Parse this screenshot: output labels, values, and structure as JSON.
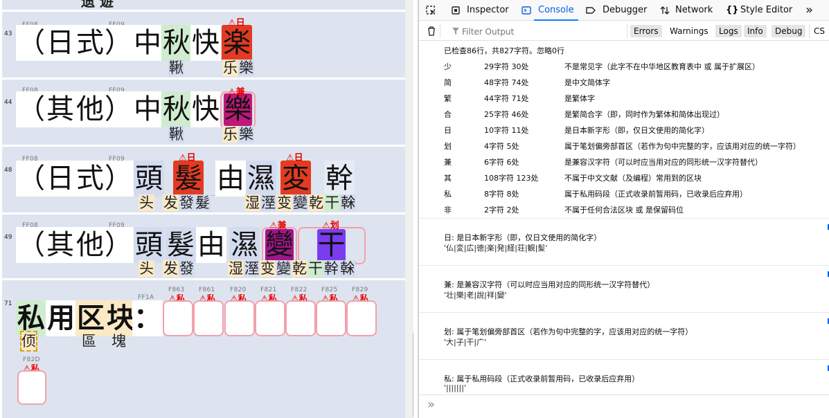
{
  "editor": {
    "top_fragment": "遗 遊",
    "lines": [
      {
        "num": "43",
        "hex1": "FF08",
        "hex2": "FF09",
        "chars": [
          "（",
          "日",
          "式",
          "）",
          "中",
          "秋",
          "快",
          "楽"
        ],
        "badge": "⚠日",
        "subs": [
          "鞦",
          "乐",
          "樂"
        ]
      },
      {
        "num": "44",
        "hex1": "FF08",
        "hex2": "FF09",
        "chars": [
          "（",
          "其",
          "他",
          "）",
          "中",
          "秋",
          "快",
          "樂"
        ],
        "badge": "⚠兼",
        "subs": [
          "鞦",
          "乐",
          "樂"
        ]
      },
      {
        "num": "48",
        "hex1": "FF08",
        "hex2": "FF09",
        "chars": [
          "（",
          "日",
          "式",
          "）",
          "頭",
          "髮",
          "由",
          "濕",
          "変",
          "幹"
        ],
        "badges": [
          "⚠日",
          "⚠日"
        ],
        "subs": [
          "头",
          "发",
          "發",
          "髮",
          "湿",
          "溼",
          "变",
          "變",
          "乾",
          "干",
          "榦"
        ]
      },
      {
        "num": "49",
        "hex1": "FF08",
        "hex2": "FF09",
        "chars": [
          "（",
          "其",
          "他",
          "）",
          "頭",
          "髮",
          "由",
          "濕",
          "變",
          "干"
        ],
        "badges": [
          "⚠兼",
          "⚠划"
        ],
        "subs": [
          "头",
          "发",
          "發",
          "湿",
          "溼",
          "变",
          "變",
          "乾",
          "干",
          "幹",
          "榦"
        ]
      },
      {
        "num": "71",
        "hex_colon": "FF1A",
        "chars": [
          "私",
          "用",
          "区",
          "块",
          "：",
          "",
          "",
          "",
          "",
          "",
          "",
          ""
        ],
        "hexes": [
          "F863",
          "F861",
          "F820",
          "F821",
          "F822",
          "F825",
          "F829",
          "F82D"
        ],
        "badge": "⚠私",
        "subs": [
          "㑔",
          "區",
          "塊"
        ]
      }
    ]
  },
  "devtools": {
    "tabs": [
      {
        "label": "Inspector"
      },
      {
        "label": "Console"
      },
      {
        "label": "Debugger"
      },
      {
        "label": "Network"
      },
      {
        "label": "Style Editor"
      }
    ],
    "more": "»",
    "filter_placeholder": "Filter Output",
    "levels": [
      "Errors",
      "Warnings",
      "Logs",
      "Info",
      "Debug",
      "CS"
    ],
    "summary": "已检查86行，共827字符。忽略0行",
    "stats": [
      {
        "k": "少",
        "n": "29字符 30处",
        "d": "不是常见字（此字不在中华地区教育表中 或 属于扩展区）"
      },
      {
        "k": "简",
        "n": "48字符 74处",
        "d": "是中文简体字"
      },
      {
        "k": "繁",
        "n": "44字符 71处",
        "d": "是繁体字"
      },
      {
        "k": "合",
        "n": "25字符 46处",
        "d": "是繁简合字（即，同时作为繁体和简体出现过）"
      },
      {
        "k": "日",
        "n": "10字符 11处",
        "d": "是日本新字形（即，仅日文使用的简化字）"
      },
      {
        "k": "划",
        "n": "4字符 5处",
        "d": "属于笔划偏旁部首区（若作为句中完整的字，应该用对应的统一字符）"
      },
      {
        "k": "兼",
        "n": "6字符 6处",
        "d": "是兼容汉字符（可以时应当用对应的同形统一汉字符替代）"
      },
      {
        "k": "其",
        "n": "108字符 123处",
        "d": "不属于中文文献（及编程）常用到的区块"
      },
      {
        "k": "私",
        "n": "8字符 8处",
        "d": "属于私用码段（正式收录前暂用码，已收录后应弃用）"
      },
      {
        "k": "非",
        "n": "2字符 2处",
        "d": "不属于任何合法区块 或 是保留码位"
      }
    ],
    "groups": [
      {
        "t": "日:   是日本新字形（即，仅日文使用的简化字）",
        "v": "'仏|変|広|徳|楽|発|経|荘|観|髪'"
      },
      {
        "t": "兼:   是兼容汉字符（可以时应当用对应的同形统一汉字符替代）",
        "v": "'壮|樂|老|說|祥|變'"
      },
      {
        "t": "划:   属于笔划偏旁部首区（若作为句中完整的字，应该用对应的统一字符）",
        "v": "'⼤|⼦|⼲|⼴'"
      },
      {
        "t": "私:   属于私用码段（正式收录前暂用码，已收录后应弃用）",
        "v": "'|||||||'"
      }
    ],
    "prompt": "»"
  }
}
